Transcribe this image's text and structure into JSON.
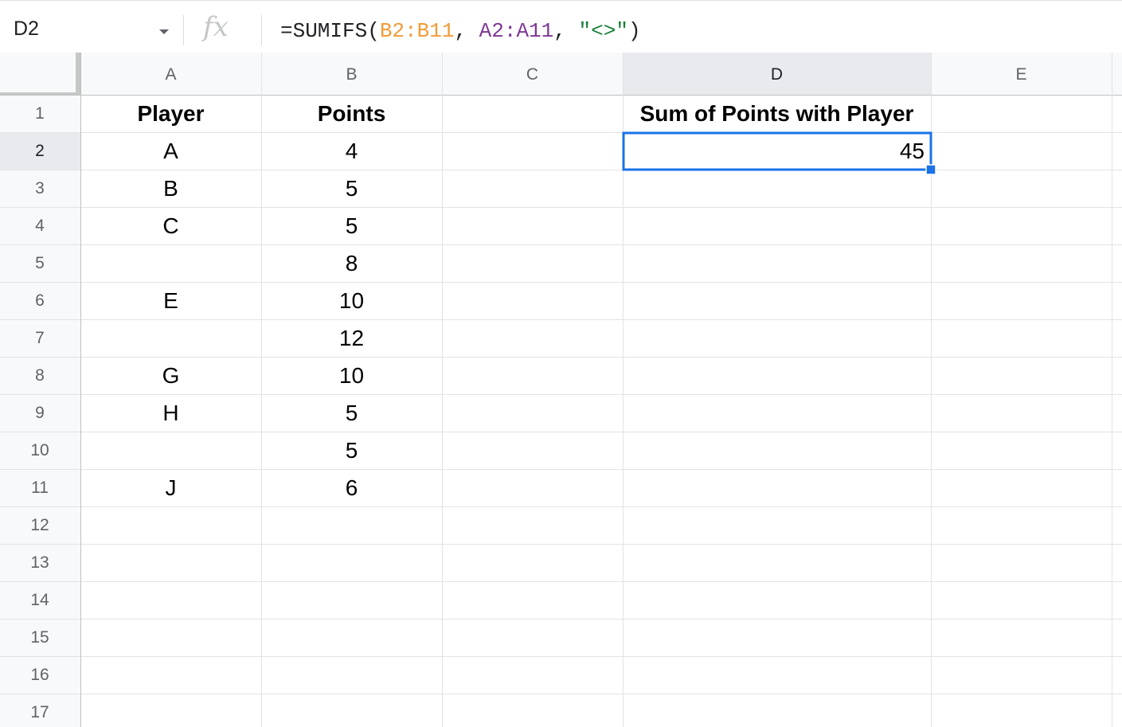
{
  "formula_bar": {
    "name_box": "D2",
    "fx_icon": "fx-icon",
    "formula": [
      {
        "text": "=SUMIFS(",
        "color": "#202124"
      },
      {
        "text": "B2:B11",
        "color": "#f29b39"
      },
      {
        "text": ", ",
        "color": "#202124"
      },
      {
        "text": "A2:A11",
        "color": "#7e3794"
      },
      {
        "text": ", ",
        "color": "#202124"
      },
      {
        "text": "\"<>\"",
        "color": "#188038"
      },
      {
        "text": ")",
        "color": "#202124"
      }
    ]
  },
  "sheet": {
    "selected_cell": {
      "col": 3,
      "row": 1
    },
    "selected_column": "D",
    "selected_row": "2",
    "accent_color": "#1a73e8",
    "columns": [
      "A",
      "B",
      "C",
      "D",
      "E"
    ],
    "rows": [
      "1",
      "2",
      "3",
      "4",
      "5",
      "6",
      "7",
      "8",
      "9",
      "10",
      "11",
      "12",
      "13",
      "14",
      "15",
      "16",
      "17"
    ],
    "cells": [
      [
        "Player",
        "Points",
        "",
        "Sum of Points with Player",
        ""
      ],
      [
        "A",
        "4",
        "",
        "45",
        ""
      ],
      [
        "B",
        "5",
        "",
        "",
        ""
      ],
      [
        "C",
        "5",
        "",
        "",
        ""
      ],
      [
        "",
        "8",
        "",
        "",
        ""
      ],
      [
        "E",
        "10",
        "",
        "",
        ""
      ],
      [
        "",
        "12",
        "",
        "",
        ""
      ],
      [
        "G",
        "10",
        "",
        "",
        ""
      ],
      [
        "H",
        "5",
        "",
        "",
        ""
      ],
      [
        "",
        "5",
        "",
        "",
        ""
      ],
      [
        "J",
        "6",
        "",
        "",
        ""
      ],
      [
        "",
        "",
        "",
        "",
        ""
      ],
      [
        "",
        "",
        "",
        "",
        ""
      ],
      [
        "",
        "",
        "",
        "",
        ""
      ],
      [
        "",
        "",
        "",
        "",
        ""
      ],
      [
        "",
        "",
        "",
        "",
        ""
      ],
      [
        "",
        "",
        "",
        "",
        ""
      ]
    ],
    "bold_rows": [
      0
    ],
    "right_aligned_cells": [
      [
        1,
        3
      ]
    ]
  }
}
